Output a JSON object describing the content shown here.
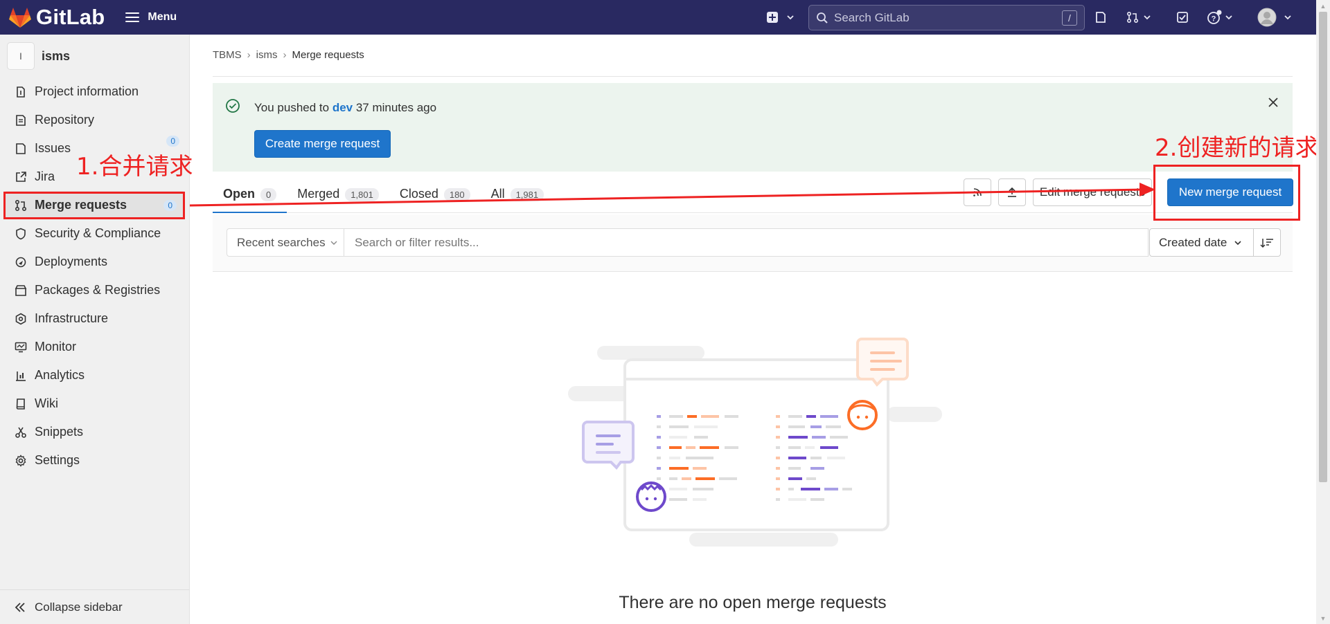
{
  "app": {
    "logo_text": "GitLab",
    "menu_label": "Menu"
  },
  "header": {
    "search_placeholder": "Search GitLab",
    "search_shortcut": "/"
  },
  "sidebar": {
    "project_avatar_letter": "I",
    "project_name": "isms",
    "items": [
      {
        "label": "Project information",
        "icon": "project-info-icon"
      },
      {
        "label": "Repository",
        "icon": "repository-icon"
      },
      {
        "label": "Issues",
        "icon": "issues-icon",
        "badge": "0"
      },
      {
        "label": "Jira",
        "icon": "jira-icon"
      },
      {
        "label": "Merge requests",
        "icon": "merge-request-icon",
        "badge": "0",
        "active": true
      },
      {
        "label": "Security & Compliance",
        "icon": "shield-icon"
      },
      {
        "label": "Deployments",
        "icon": "deployments-icon"
      },
      {
        "label": "Packages & Registries",
        "icon": "package-icon"
      },
      {
        "label": "Infrastructure",
        "icon": "infrastructure-icon"
      },
      {
        "label": "Monitor",
        "icon": "monitor-icon"
      },
      {
        "label": "Analytics",
        "icon": "analytics-icon"
      },
      {
        "label": "Wiki",
        "icon": "wiki-icon"
      },
      {
        "label": "Snippets",
        "icon": "snippets-icon"
      },
      {
        "label": "Settings",
        "icon": "settings-icon"
      }
    ],
    "collapse_label": "Collapse sidebar"
  },
  "breadcrumb": {
    "items": [
      "TBMS",
      "isms",
      "Merge requests"
    ]
  },
  "alert": {
    "prefix": "You pushed to ",
    "branch": "dev",
    "suffix": " 37 minutes ago",
    "button_label": "Create merge request"
  },
  "tabs": [
    {
      "label": "Open",
      "count": "0",
      "active": true
    },
    {
      "label": "Merged",
      "count": "1,801"
    },
    {
      "label": "Closed",
      "count": "180"
    },
    {
      "label": "All",
      "count": "1,981"
    }
  ],
  "actions": {
    "edit_label": "Edit merge requests",
    "new_label": "New merge request"
  },
  "filter": {
    "recent_label": "Recent searches",
    "placeholder": "Search or filter results...",
    "sort_label": "Created date"
  },
  "empty_state": {
    "title": "There are no open merge requests"
  },
  "annotations": {
    "step1": "1.合并请求",
    "step2": "2.创建新的请求"
  },
  "colors": {
    "topbar": "#292961",
    "accent_blue": "#1f75cb",
    "annotation_red": "#ee2222",
    "alert_bg": "#ecf4ee"
  }
}
